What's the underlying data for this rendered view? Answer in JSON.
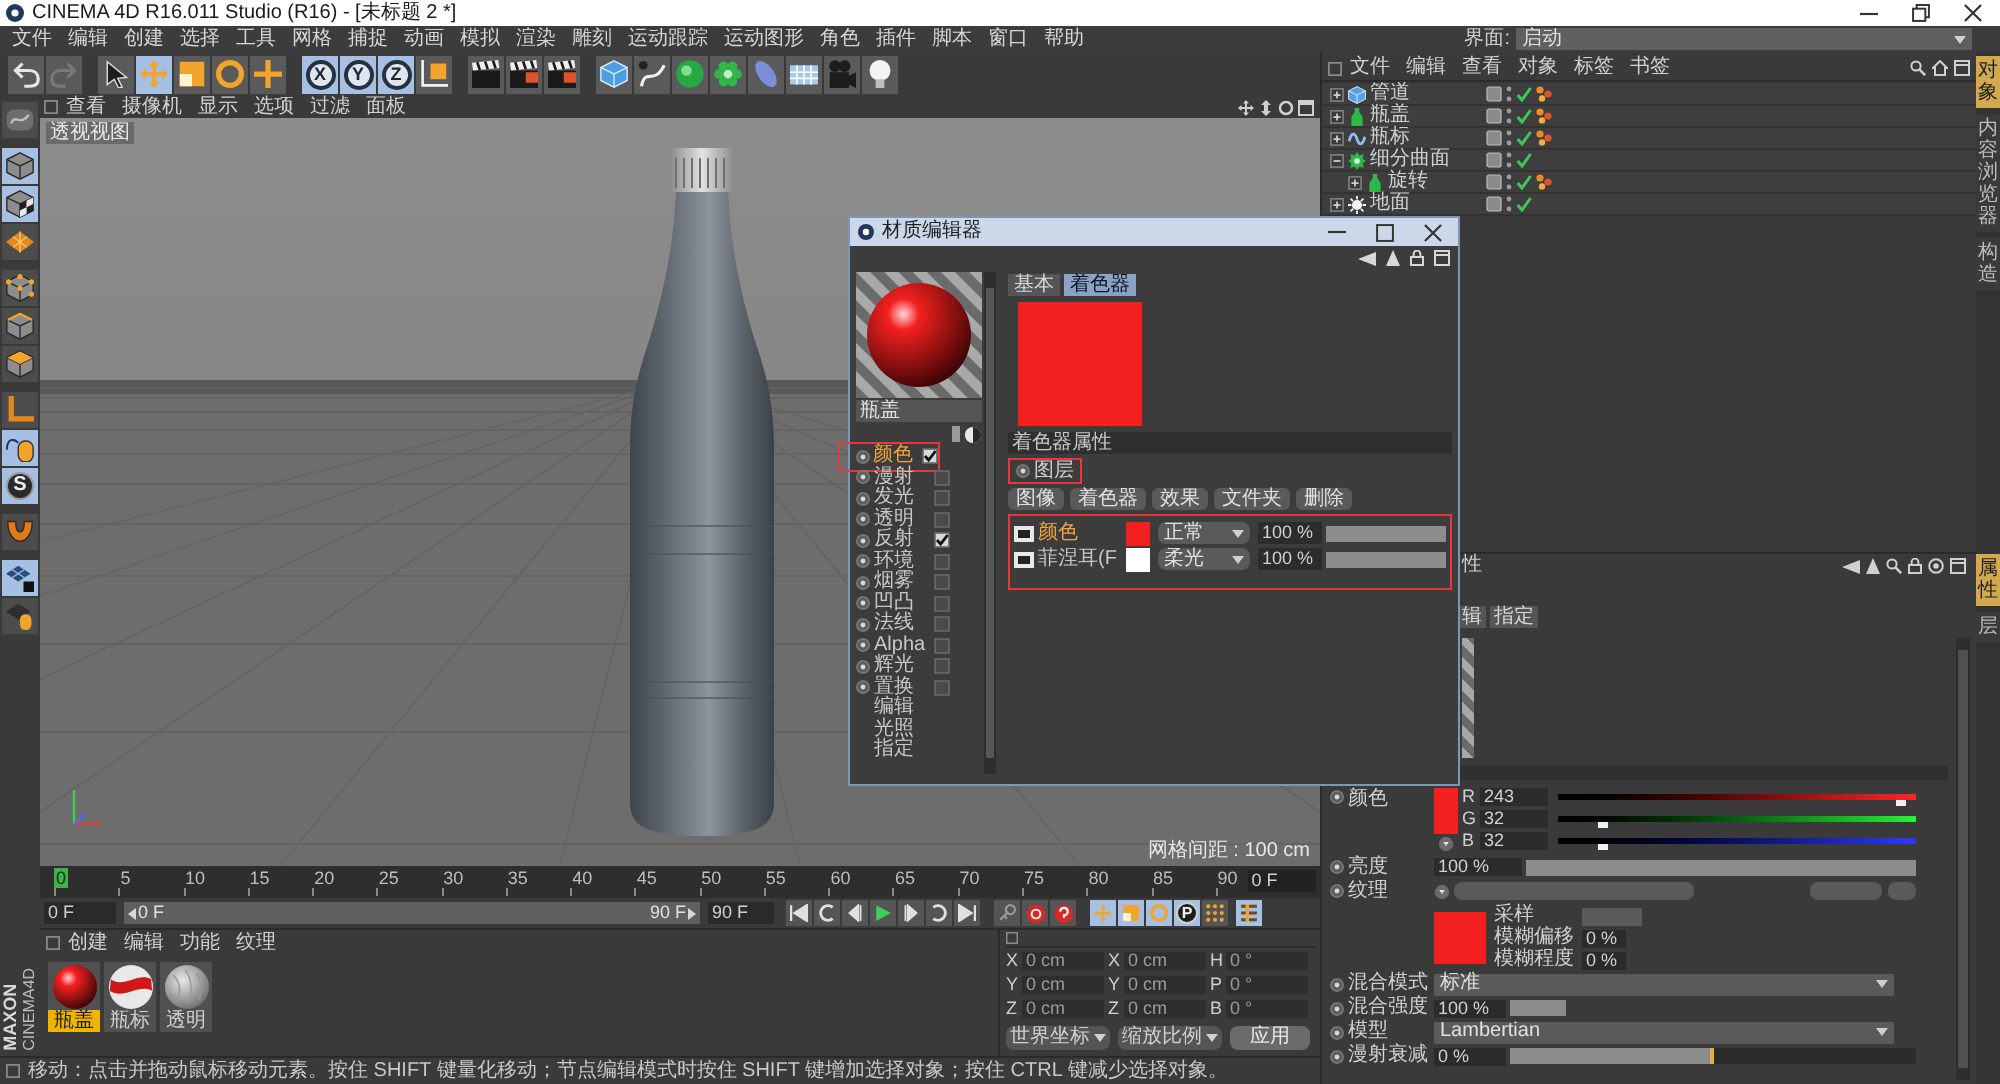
{
  "window": {
    "title": "CINEMA 4D R16.011 Studio (R16) - [未标题 2 *]"
  },
  "menu_bar": [
    "文件",
    "编辑",
    "创建",
    "选择",
    "工具",
    "网格",
    "捕捉",
    "动画",
    "模拟",
    "渲染",
    "雕刻",
    "运动跟踪",
    "运动图形",
    "角色",
    "插件",
    "脚本",
    "窗口",
    "帮助"
  ],
  "layout": {
    "label": "界面:",
    "value": "启动"
  },
  "toolbar": [
    {
      "kind": "undo",
      "selected": false
    },
    {
      "kind": "redo",
      "selected": false
    },
    {
      "kind": "select",
      "selected": false
    },
    {
      "kind": "move",
      "selected": true
    },
    {
      "kind": "scale",
      "selected": false
    },
    {
      "kind": "rotate",
      "selected": false
    },
    {
      "kind": "add",
      "selected": false
    },
    {
      "kind": "axis",
      "label": "X",
      "selected": true
    },
    {
      "kind": "axis",
      "label": "Y",
      "selected": true
    },
    {
      "kind": "axis",
      "label": "Z",
      "selected": true
    },
    {
      "kind": "coords",
      "selected": false
    },
    {
      "kind": "render",
      "selected": false
    },
    {
      "kind": "render-view",
      "selected": false
    },
    {
      "kind": "render-settings",
      "selected": false
    },
    {
      "kind": "cube",
      "selected": false
    },
    {
      "kind": "pen",
      "selected": false
    },
    {
      "kind": "nurbs",
      "selected": false
    },
    {
      "kind": "array",
      "selected": false
    },
    {
      "kind": "deformer",
      "selected": false
    },
    {
      "kind": "floor",
      "selected": false
    },
    {
      "kind": "camera",
      "selected": false
    },
    {
      "kind": "light",
      "selected": false
    }
  ],
  "left_toolbar": [
    {
      "kind": "display",
      "selected": false
    },
    {
      "kind": "model",
      "selected": true
    },
    {
      "kind": "texture",
      "selected": true
    },
    {
      "kind": "workplane",
      "selected": false
    },
    {
      "kind": "points",
      "selected": false
    },
    {
      "kind": "edges",
      "selected": false
    },
    {
      "kind": "polygons",
      "selected": false
    },
    {
      "kind": "axis",
      "selected": false
    },
    {
      "kind": "tweak",
      "selected": true
    },
    {
      "kind": "snap",
      "label": "S",
      "selected": true
    },
    {
      "kind": "magnet",
      "selected": false
    },
    {
      "kind": "workplane-lock",
      "selected": true
    },
    {
      "kind": "grid-select",
      "selected": false
    }
  ],
  "logo": {
    "brand": "MAXON",
    "product": "CINEMA4D"
  },
  "viewport": {
    "menu": [
      "查看",
      "摄像机",
      "显示",
      "选项",
      "过滤",
      "面板"
    ],
    "label": "透视视图",
    "grid_spacing": "网格间距 : 100 cm"
  },
  "timeline": {
    "ticks": [
      {
        "label": "0",
        "selected": true
      },
      {
        "label": "5",
        "selected": false
      },
      {
        "label": "10",
        "selected": false
      },
      {
        "label": "15",
        "selected": false
      },
      {
        "label": "20",
        "selected": false
      },
      {
        "label": "25",
        "selected": false
      },
      {
        "label": "30",
        "selected": false
      },
      {
        "label": "35",
        "selected": false
      },
      {
        "label": "40",
        "selected": false
      },
      {
        "label": "45",
        "selected": false
      },
      {
        "label": "50",
        "selected": false
      },
      {
        "label": "55",
        "selected": false
      },
      {
        "label": "60",
        "selected": false
      },
      {
        "label": "65",
        "selected": false
      },
      {
        "label": "70",
        "selected": false
      },
      {
        "label": "75",
        "selected": false
      },
      {
        "label": "80",
        "selected": false
      },
      {
        "label": "85",
        "selected": false
      },
      {
        "label": "90",
        "selected": false
      }
    ],
    "frame": "0 F"
  },
  "transport": {
    "start": "0 F",
    "range": {
      "start": "0 F",
      "end": "90 F",
      "level": 1
    },
    "end": "90 F",
    "key_buttons": [
      {
        "kind": "position",
        "selected": true
      },
      {
        "kind": "scale",
        "selected": true
      },
      {
        "kind": "rotation",
        "selected": true
      },
      {
        "kind": "parameter",
        "label": "P",
        "selected": true
      },
      {
        "kind": "point-level",
        "selected": false
      }
    ]
  },
  "material_manager": {
    "menu": [
      "创建",
      "编辑",
      "功能",
      "纹理"
    ],
    "materials": [
      {
        "name": "瓶盖",
        "kind": "glossy",
        "selected": true
      },
      {
        "name": "瓶标",
        "kind": "striped",
        "selected": false
      },
      {
        "name": "透明",
        "kind": "clear",
        "selected": false
      }
    ]
  },
  "coordinates": {
    "rows": [
      {
        "cells": [
          {
            "axis": "X",
            "value": "0 cm"
          },
          {
            "axis": "X",
            "value": "0 cm"
          },
          {
            "axis": "H",
            "value": "0 °"
          }
        ]
      },
      {
        "cells": [
          {
            "axis": "Y",
            "value": "0 cm"
          },
          {
            "axis": "Y",
            "value": "0 cm"
          },
          {
            "axis": "P",
            "value": "0 °"
          }
        ]
      },
      {
        "cells": [
          {
            "axis": "Z",
            "value": "0 cm"
          },
          {
            "axis": "Z",
            "value": "0 cm"
          },
          {
            "axis": "B",
            "value": "0 °"
          }
        ]
      }
    ],
    "space": "世界坐标",
    "scale_mode": "缩放比例",
    "apply": "应用"
  },
  "status_bar": "移动：点击并拖动鼠标移动元素。按住 SHIFT 键量化移动；节点编辑模式时按住 SHIFT 键增加选择对象；按住 CTRL 键减少选择对象。",
  "object_manager": {
    "menu": [
      "文件",
      "编辑",
      "查看",
      "对象",
      "标签",
      "书签"
    ],
    "objects": [
      {
        "name": "管道",
        "kind": "primitive",
        "expanded": false,
        "enabled": true,
        "material_tag": true
      },
      {
        "name": "瓶盖",
        "kind": "lathe",
        "expanded": false,
        "enabled": true,
        "material_tag": true
      },
      {
        "name": "瓶标",
        "kind": "spline",
        "expanded": false,
        "enabled": true,
        "material_tag": true
      },
      {
        "name": "细分曲面",
        "kind": "subdivision",
        "expanded": true,
        "enabled": true,
        "material_tag": false,
        "children": [
          {
            "name": "旋转",
            "kind": "lathe",
            "expanded": false,
            "enabled": true,
            "material_tag": true
          }
        ]
      },
      {
        "name": "地面",
        "kind": "sky",
        "expanded": false,
        "enabled": true,
        "material_tag": false
      }
    ]
  },
  "side_tabs": [
    {
      "label": "对象",
      "selected": true
    },
    {
      "label": "内容浏览器",
      "selected": false
    },
    {
      "label": "构造",
      "selected": false
    }
  ],
  "side_tabs_lower": [
    {
      "label": "属性",
      "selected": true
    },
    {
      "label": "层",
      "selected": false
    }
  ],
  "attributes": {
    "title": "性",
    "tabs": [
      {
        "label": "辑",
        "selected": false
      },
      {
        "label": "指定",
        "selected": false
      }
    ],
    "color": {
      "label": "颜色",
      "channels": [
        {
          "label": "R",
          "value": "243",
          "level": 0.953
        },
        {
          "label": "G",
          "value": "32",
          "level": 0.125
        },
        {
          "label": "B",
          "value": "32",
          "level": 0.125
        }
      ]
    },
    "brightness": {
      "label": "亮度",
      "value": "100 %",
      "level": 1
    },
    "texture": {
      "label": "纹理"
    },
    "sampling": {
      "label": "采样"
    },
    "blur_offset": {
      "label": "模糊偏移",
      "value": "0 %"
    },
    "blur_scale": {
      "label": "模糊程度",
      "value": "0 %"
    },
    "blend_mode": {
      "label": "混合模式",
      "value": "标准"
    },
    "blend_strength": {
      "label": "混合强度",
      "value": "100 %",
      "level": 1
    },
    "model": {
      "label": "模型",
      "value": "Lambertian"
    },
    "diffuse_falloff": {
      "label": "漫射衰减",
      "value": "0 %",
      "level": 0.5
    }
  },
  "material_editor": {
    "title": "材质编辑器",
    "name": "瓶盖",
    "channels": [
      {
        "label": "颜色",
        "checked": true,
        "selected": true,
        "annotated": true
      },
      {
        "label": "漫射",
        "checked": false,
        "selected": false,
        "annotated": false
      },
      {
        "label": "发光",
        "checked": false,
        "selected": false,
        "annotated": false
      },
      {
        "label": "透明",
        "checked": false,
        "selected": false,
        "annotated": false
      },
      {
        "label": "反射",
        "checked": true,
        "selected": false,
        "annotated": false
      },
      {
        "label": "环境",
        "checked": false,
        "selected": false,
        "annotated": false
      },
      {
        "label": "烟雾",
        "checked": false,
        "selected": false,
        "annotated": false
      },
      {
        "label": "凹凸",
        "checked": false,
        "selected": false,
        "annotated": false
      },
      {
        "label": "法线",
        "checked": false,
        "selected": false,
        "annotated": false
      },
      {
        "label": "Alpha",
        "checked": false,
        "selected": false,
        "annotated": false
      },
      {
        "label": "辉光",
        "checked": false,
        "selected": false,
        "annotated": false
      },
      {
        "label": "置换",
        "checked": false,
        "selected": false,
        "annotated": false
      }
    ],
    "pages": [
      "编辑",
      "光照",
      "指定"
    ],
    "tabs": [
      {
        "label": "基本",
        "selected": false
      },
      {
        "label": "着色器",
        "selected": true
      }
    ],
    "section": "着色器属性",
    "group": {
      "label": "图层",
      "annotated": true
    },
    "buttons": [
      "图像",
      "着色器",
      "效果",
      "文件夹",
      "删除"
    ],
    "layers_annotated": true,
    "layers": [
      {
        "name": "颜色",
        "selected": true,
        "color": "#f32020",
        "mode": "正常",
        "amount": "100 %",
        "level": 1
      },
      {
        "name": "菲涅耳(F",
        "selected": false,
        "color": "#ffffff",
        "mode": "柔光",
        "amount": "100 %",
        "level": 1
      }
    ]
  }
}
